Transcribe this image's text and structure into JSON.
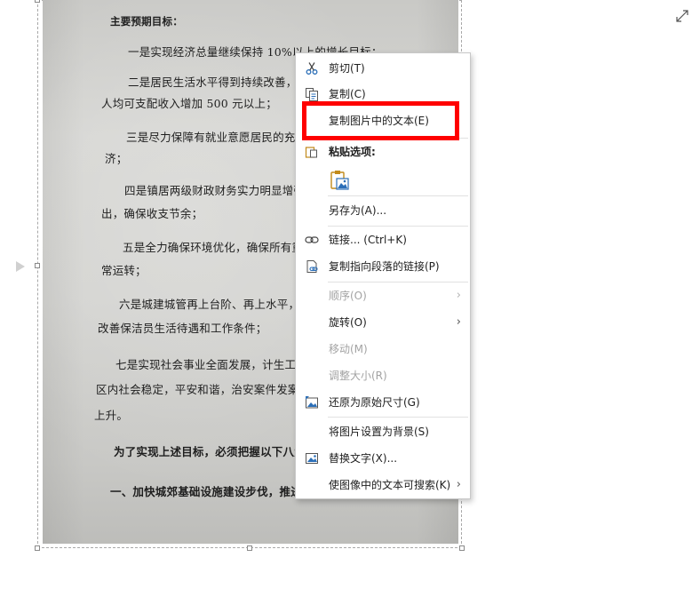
{
  "document_lines": [
    "主要预期目标：",
    "一是实现经济总量继续保持 10%以上的增长目标；",
    "二是居民生活水平得到持续改善，农村居",
    "人均可支配收入增加 500 元以上；",
    "三是尽力保障有就业意愿居民的充分就业",
    "济；",
    "四是镇居两级财政财务实力明显增强，确",
    "出，确保收支节余；",
    "五是全力确保环境优化，确保所有重点项",
    "常运转；",
    "六是城建城管再上台阶、再上水平，继续",
    "改善保洁员生活待遇和工作条件；",
    "七是实现社会事业全面发展，计生工作",
    "区内社会稳定，平安和谐，治安案件发案率",
    "上升。",
    "为了实现上述目标，必须把握以下八大",
    "一、加快城郊基础设施建设步伐，推进"
  ],
  "context_menu": {
    "cut": "剪切(T)",
    "copy": "复制(C)",
    "copy_text_from_picture": "复制图片中的文本(E)",
    "paste_options": "粘贴选项:",
    "save_as": "另存为(A)...",
    "link": "链接...  (Ctrl+K)",
    "copy_link_to_paragraph": "复制指向段落的链接(P)",
    "order": "顺序(O)",
    "rotate": "旋转(O)",
    "move": "移动(M)",
    "resize": "调整大小(R)",
    "reset_size": "还原为原始尺寸(G)",
    "set_as_background": "将图片设置为背景(S)",
    "alt_text": "替换文字(X)...",
    "make_searchable": "使图像中的文本可搜索(K)"
  },
  "icons": {
    "expand": "expand-icon",
    "cut": "scissors-icon",
    "copy": "copy-icon",
    "paste": "clipboard-icon",
    "paste_picture": "paste-picture-icon",
    "link": "link-icon",
    "paragraph_link": "paragraph-link-icon",
    "reset_size": "reset-picture-icon",
    "alt_text": "alt-text-icon"
  },
  "colors": {
    "highlight": "#ff0000",
    "menu_bg": "#ffffff",
    "disabled_text": "#a3a3a3"
  }
}
